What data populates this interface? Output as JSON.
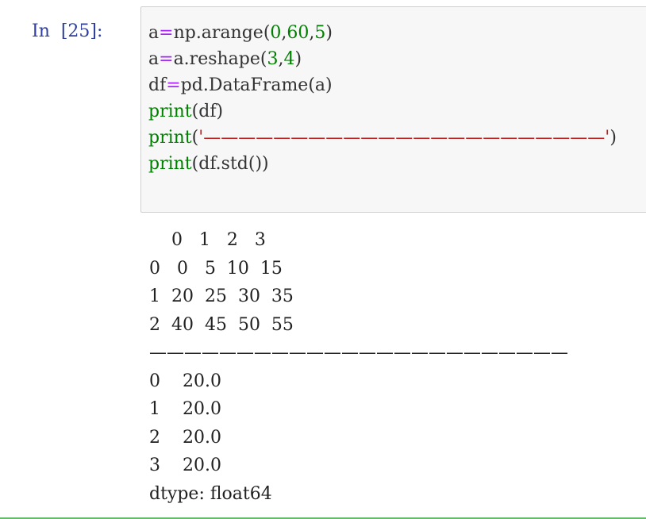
{
  "prompt": "In  [25]:",
  "code_lines": [
    [
      {
        "t": "a",
        "c": ""
      },
      {
        "t": "=",
        "c": "op"
      },
      {
        "t": "np.arange(",
        "c": ""
      },
      {
        "t": "0",
        "c": "num"
      },
      {
        "t": ",",
        "c": ""
      },
      {
        "t": "60",
        "c": "num"
      },
      {
        "t": ",",
        "c": ""
      },
      {
        "t": "5",
        "c": "num"
      },
      {
        "t": ")",
        "c": ""
      }
    ],
    [
      {
        "t": "a",
        "c": ""
      },
      {
        "t": "=",
        "c": "op"
      },
      {
        "t": "a.reshape(",
        "c": ""
      },
      {
        "t": "3",
        "c": "num"
      },
      {
        "t": ",",
        "c": ""
      },
      {
        "t": "4",
        "c": "num"
      },
      {
        "t": ")",
        "c": ""
      }
    ],
    [
      {
        "t": "df",
        "c": ""
      },
      {
        "t": "=",
        "c": "op"
      },
      {
        "t": "pd.DataFrame(a)",
        "c": ""
      }
    ],
    [
      {
        "t": "print",
        "c": "kw"
      },
      {
        "t": "(df)",
        "c": ""
      }
    ],
    [
      {
        "t": "print",
        "c": "kw"
      },
      {
        "t": "(",
        "c": ""
      },
      {
        "t": "'———————————————————————'",
        "c": "str"
      },
      {
        "t": ")",
        "c": ""
      }
    ],
    [
      {
        "t": "print",
        "c": "kw"
      },
      {
        "t": "(df.std())",
        "c": ""
      }
    ]
  ],
  "output_lines": [
    "    0   1   2   3",
    "0   0   5  10  15",
    "1  20  25  30  35",
    "2  40  45  50  55",
    "————————————————————————",
    "0    20.0",
    "1    20.0",
    "2    20.0",
    "3    20.0",
    "dtype: float64"
  ],
  "colors": {
    "prompt": "#303f9f",
    "keyword": "#008000",
    "number": "#008000",
    "operator": "#aa22ff",
    "string": "#ba2121",
    "input_bg": "#f7f7f7",
    "selected_border": "#66bb6a"
  }
}
